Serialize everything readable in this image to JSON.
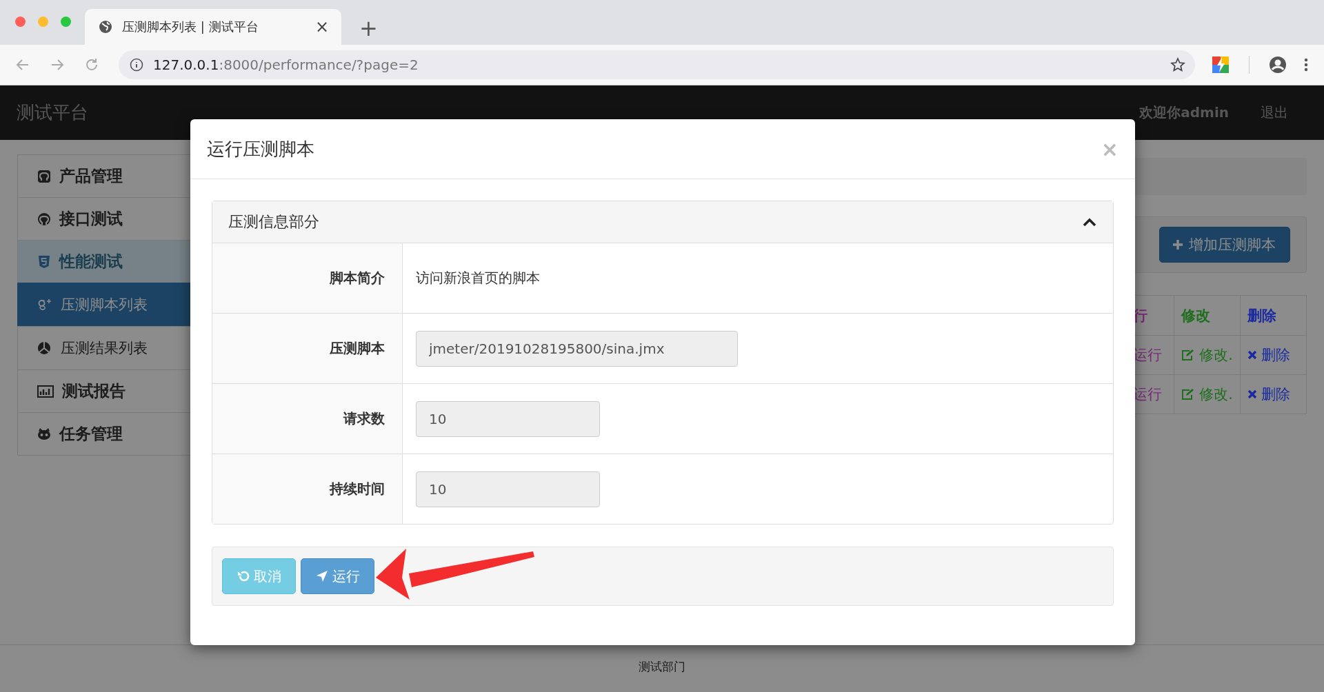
{
  "browser": {
    "tab_title": "压测脚本列表 | 测试平台",
    "tab_close": "×",
    "new_tab": "+",
    "address": {
      "host": "127.0.0.1",
      "path": ":8000/performance/?page=2"
    }
  },
  "navbar": {
    "brand": "测试平台",
    "user": "欢迎你admin",
    "logout": "退出"
  },
  "sidebar": {
    "items": [
      {
        "label": "产品管理",
        "selected": false
      },
      {
        "label": "接口测试",
        "selected": false
      },
      {
        "label": "性能测试",
        "selected": true,
        "children": [
          {
            "label": "压测脚本列表",
            "selected": true
          },
          {
            "label": "压测结果列表",
            "selected": false
          }
        ]
      },
      {
        "label": "测试报告",
        "selected": false
      },
      {
        "label": "任务管理",
        "selected": false
      }
    ]
  },
  "toolbar": {
    "add_button": "增加压测脚本"
  },
  "table": {
    "columns": [
      {
        "label": "行",
        "color": "#7a2a7a"
      },
      {
        "label": "修改",
        "color": "#1e6e1e"
      },
      {
        "label": "删除",
        "color": "#1a2aa0"
      }
    ],
    "rows": [
      [
        "运行",
        "修改.",
        "删除"
      ],
      [
        "运行",
        "修改.",
        "删除"
      ]
    ]
  },
  "footer": {
    "text": "测试部门"
  },
  "modal": {
    "title": "运行压测脚本",
    "close": "×",
    "panel": {
      "title": "压测信息部分",
      "expanded": true,
      "fields": [
        {
          "label": "脚本简介",
          "kind": "text",
          "value": "访问新浪首页的脚本"
        },
        {
          "label": "压测脚本",
          "kind": "input",
          "value": "jmeter/20191028195800/sina.jmx",
          "wide": true
        },
        {
          "label": "请求数",
          "kind": "input",
          "value": "10",
          "wide": false
        },
        {
          "label": "持续时间",
          "kind": "input",
          "value": "10",
          "wide": false
        }
      ]
    },
    "buttons": [
      {
        "label": "取消",
        "kind": "cancel"
      },
      {
        "label": "运行",
        "kind": "run"
      }
    ]
  }
}
